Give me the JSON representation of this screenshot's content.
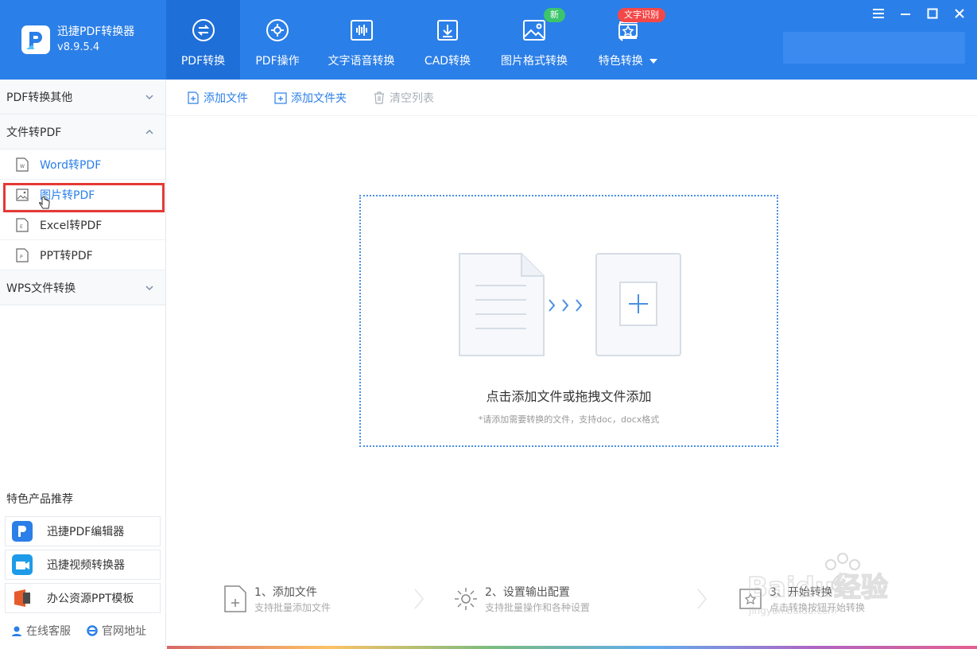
{
  "app": {
    "name": "迅捷PDF转换器",
    "version": "v8.9.5.4"
  },
  "colors": {
    "primary": "#2b7fe8",
    "primary_dark": "#1f6fd8",
    "badge_new": "#3cc56b",
    "badge_ocr": "#f44848",
    "highlight": "#e53935"
  },
  "nav": {
    "tabs": [
      {
        "label": "PDF转换",
        "icon": "pdf-convert-icon",
        "active": true
      },
      {
        "label": "PDF操作",
        "icon": "pdf-operate-icon"
      },
      {
        "label": "文字语音转换",
        "icon": "audio-wave-icon"
      },
      {
        "label": "CAD转换",
        "icon": "cad-download-icon"
      },
      {
        "label": "图片格式转换",
        "icon": "image-icon",
        "badge": "新"
      },
      {
        "label": "特色转换",
        "icon": "star-refresh-icon",
        "badge": "文字识别",
        "dropdown": true
      }
    ]
  },
  "window": {
    "menu": "menu-icon",
    "minimize": "minimize-icon",
    "maximize": "maximize-icon",
    "close": "close-icon"
  },
  "sidebar": {
    "sections": [
      {
        "label": "PDF转换其他",
        "expanded": false
      },
      {
        "label": "文件转PDF",
        "expanded": true,
        "items": [
          {
            "label": "Word转PDF",
            "icon": "word-file-icon"
          },
          {
            "label": "图片转PDF",
            "icon": "image-file-icon",
            "selected": true
          },
          {
            "label": "Excel转PDF",
            "icon": "excel-file-icon"
          },
          {
            "label": "PPT转PDF",
            "icon": "ppt-file-icon"
          }
        ]
      },
      {
        "label": "WPS文件转换",
        "expanded": false
      }
    ],
    "promo_title": "特色产品推荐",
    "promos": [
      {
        "label": "迅捷PDF编辑器",
        "icon": "pdf-editor-icon"
      },
      {
        "label": "迅捷视频转换器",
        "icon": "video-converter-icon"
      },
      {
        "label": "办公资源PPT模板",
        "icon": "ppt-template-icon"
      }
    ],
    "links": {
      "service": "在线客服",
      "website": "官网地址"
    }
  },
  "toolbar": {
    "add_file": "添加文件",
    "add_folder": "添加文件夹",
    "clear_list": "清空列表"
  },
  "dropzone": {
    "title": "点击添加文件或拖拽文件添加",
    "hint": "*请添加需要转换的文件，支持doc，docx格式"
  },
  "steps": [
    {
      "title": "1、添加文件",
      "sub": "支持批量添加文件",
      "icon": "add-file-icon"
    },
    {
      "title": "2、设置输出配置",
      "sub": "支持批量操作和各种设置",
      "icon": "settings-gear-icon"
    },
    {
      "title": "3、开始转换",
      "sub": "点击转换按钮开始转换",
      "icon": "convert-icon"
    }
  ],
  "watermark": {
    "text": "Baidu经验",
    "sub": "jingyan.baidu.com"
  }
}
